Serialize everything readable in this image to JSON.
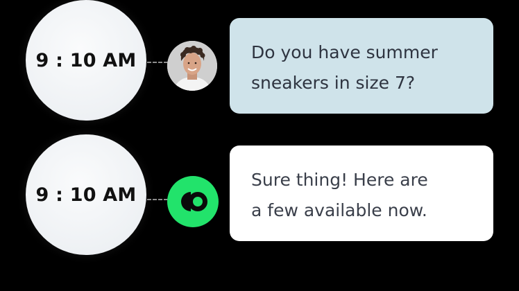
{
  "conversation": {
    "messages": [
      {
        "time": "9 : 10 AM",
        "sender": "customer",
        "avatar_icon": "customer-photo-avatar",
        "lines": [
          "Do you have summer",
          "sneakers in size 7?"
        ],
        "bubble_color": "#cfe3ea"
      },
      {
        "time": "9 : 10 AM",
        "sender": "brand",
        "avatar_icon": "brand-logo-icon",
        "lines": [
          "Sure thing! Here are",
          "a few available now."
        ],
        "bubble_color": "#ffffff",
        "brand_color": "#22e36b"
      }
    ]
  }
}
